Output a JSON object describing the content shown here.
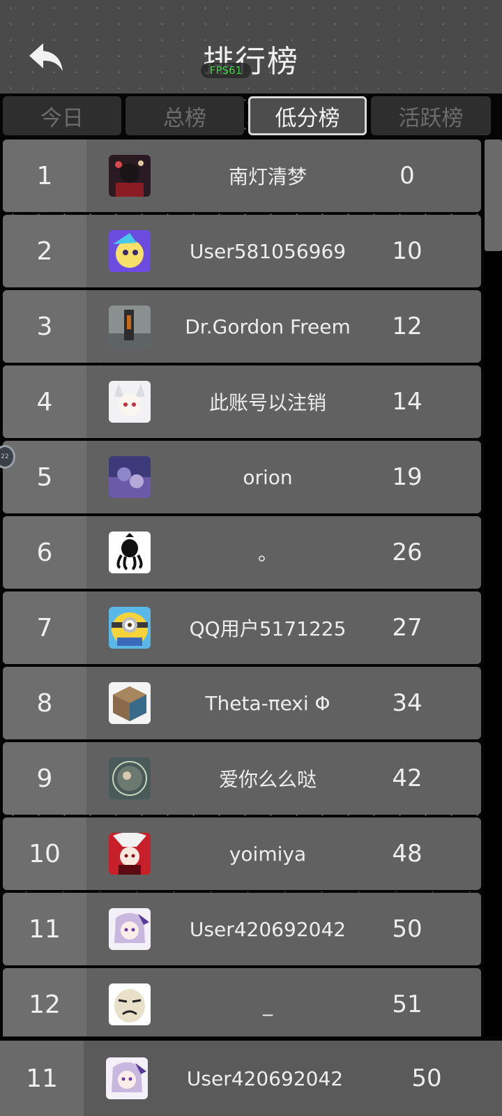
{
  "header": {
    "title": "排行榜",
    "fps_label": "FPS61",
    "back_icon": "back-arrow-icon"
  },
  "tabs": [
    {
      "label": "今日",
      "active": false
    },
    {
      "label": "总榜",
      "active": false
    },
    {
      "label": "低分榜",
      "active": true
    },
    {
      "label": "活跃榜",
      "active": false
    }
  ],
  "rows": [
    {
      "rank": "1",
      "name": "南灯清梦",
      "score": "0"
    },
    {
      "rank": "2",
      "name": "User581056969",
      "score": "10"
    },
    {
      "rank": "3",
      "name": "Dr.Gordon Freem",
      "score": "12"
    },
    {
      "rank": "4",
      "name": "此账号以注销",
      "score": "14"
    },
    {
      "rank": "5",
      "name": "orion",
      "score": "19"
    },
    {
      "rank": "6",
      "name": "。",
      "score": "26"
    },
    {
      "rank": "7",
      "name": "QQ用户5171225",
      "score": "27"
    },
    {
      "rank": "8",
      "name": "Theta-πexi Φ",
      "score": "34"
    },
    {
      "rank": "9",
      "name": "爱你么么哒",
      "score": "42"
    },
    {
      "rank": "10",
      "name": "yoimiya",
      "score": "48"
    },
    {
      "rank": "11",
      "name": "User420692042",
      "score": "50"
    },
    {
      "rank": "12",
      "name": "_",
      "score": "51"
    }
  ],
  "my_rank": {
    "rank": "11",
    "name": "User420692042",
    "score": "50"
  },
  "floating_bubble": {
    "label": "22"
  },
  "colors": {
    "header_bg": "#4a4a4a",
    "row_bg": "#616161",
    "rank_bg": "#6e6e6e",
    "fps_green": "#3fd04a"
  }
}
